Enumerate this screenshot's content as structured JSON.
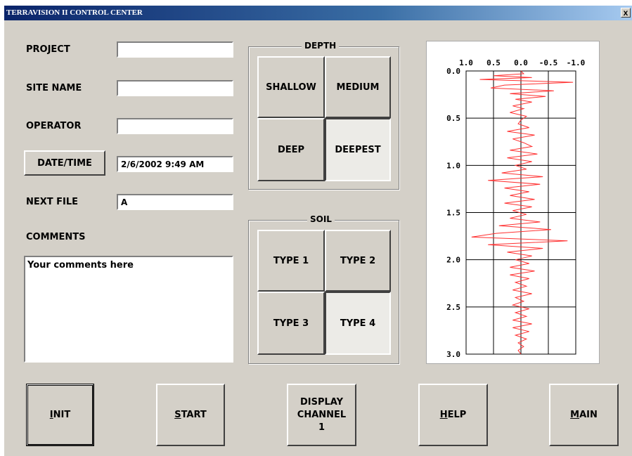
{
  "window": {
    "title": "TERRAVISION II CONTROL CENTER",
    "close_glyph": "x"
  },
  "form": {
    "project_label": "PROJECT",
    "project_value": "",
    "site_label": "SITE NAME",
    "site_value": "",
    "operator_label": "OPERATOR",
    "operator_value": "",
    "datetime_button": "DATE/TIME",
    "datetime_value": "2/6/2002  9:49 AM",
    "next_file_label": "NEXT FILE",
    "next_file_value": "A",
    "comments_label": "COMMENTS",
    "comments_value": "Your comments here"
  },
  "depth": {
    "title": "DEPTH",
    "options": [
      "SHALLOW",
      "MEDIUM",
      "DEEP",
      "DEEPEST"
    ],
    "selected": "DEEPEST"
  },
  "soil": {
    "title": "SOIL",
    "options": [
      "TYPE 1",
      "TYPE 2",
      "TYPE 3",
      "TYPE 4"
    ],
    "selected": "TYPE 4"
  },
  "buttons": {
    "init_hot": "I",
    "init_rest": "NIT",
    "start_hot": "S",
    "start_rest": "TART",
    "display_line1": "DISPLAY",
    "display_line2": "CHANNEL",
    "display_line3": "1",
    "help_hot": "H",
    "help_rest": "ELP",
    "main_hot": "M",
    "main_rest": "AIN"
  },
  "chart_data": {
    "type": "line",
    "x_tick_labels": [
      "1.0",
      "0.5",
      "0.0",
      "-0.5",
      "-1.0"
    ],
    "x_ticks": [
      1.0,
      0.5,
      0.0,
      -0.5,
      -1.0
    ],
    "y_tick_labels": [
      "0.0",
      "0.5",
      "1.0",
      "1.5",
      "2.0",
      "2.5",
      "3.0"
    ],
    "y_ticks": [
      0.0,
      0.5,
      1.0,
      1.5,
      2.0,
      2.5,
      3.0
    ],
    "xlim": [
      1.0,
      -1.0
    ],
    "ylim": [
      0.0,
      3.0
    ],
    "x_reversed": true,
    "y_down": true,
    "grid": true,
    "line_color": "#ff3030",
    "series": [
      {
        "depth": [
          0.0,
          0.03,
          0.05,
          0.07,
          0.09,
          0.12,
          0.15,
          0.18,
          0.21,
          0.24,
          0.27,
          0.3,
          0.33,
          0.37,
          0.4,
          0.44,
          0.48,
          0.52,
          0.56,
          0.6,
          0.64,
          0.68,
          0.72,
          0.76,
          0.8,
          0.84,
          0.88,
          0.92,
          0.96,
          1.0,
          1.04,
          1.08,
          1.12,
          1.16,
          1.2,
          1.24,
          1.28,
          1.32,
          1.36,
          1.4,
          1.44,
          1.48,
          1.52,
          1.56,
          1.6,
          1.64,
          1.68,
          1.72,
          1.76,
          1.8,
          1.84,
          1.88,
          1.92,
          1.96,
          2.0,
          2.04,
          2.08,
          2.12,
          2.16,
          2.2,
          2.24,
          2.28,
          2.32,
          2.36,
          2.4,
          2.44,
          2.48,
          2.52,
          2.56,
          2.6,
          2.64,
          2.68,
          2.72,
          2.76,
          2.8,
          2.84,
          2.88,
          2.92,
          2.96,
          3.0
        ],
        "value": [
          0.0,
          -0.05,
          0.5,
          -0.2,
          0.75,
          -0.95,
          0.3,
          0.55,
          -0.6,
          0.2,
          -0.45,
          0.1,
          -0.2,
          0.15,
          -0.05,
          0.2,
          -0.1,
          0.0,
          0.05,
          -0.15,
          0.25,
          -0.25,
          0.15,
          -0.05,
          -0.2,
          0.2,
          -0.3,
          0.25,
          -0.2,
          0.1,
          -0.1,
          0.35,
          -0.4,
          0.6,
          -0.35,
          0.3,
          -0.15,
          0.2,
          -0.25,
          0.3,
          -0.2,
          0.15,
          -0.1,
          0.2,
          -0.35,
          0.4,
          -0.55,
          0.45,
          0.9,
          -0.85,
          0.6,
          -0.4,
          0.25,
          -0.2,
          0.1,
          -0.15,
          0.2,
          -0.25,
          0.2,
          -0.15,
          0.1,
          -0.1,
          0.15,
          -0.2,
          0.1,
          -0.05,
          0.15,
          -0.15,
          0.1,
          -0.1,
          0.15,
          -0.2,
          0.15,
          -0.15,
          0.1,
          -0.1,
          0.05,
          -0.05,
          0.05,
          0.0
        ]
      }
    ]
  }
}
